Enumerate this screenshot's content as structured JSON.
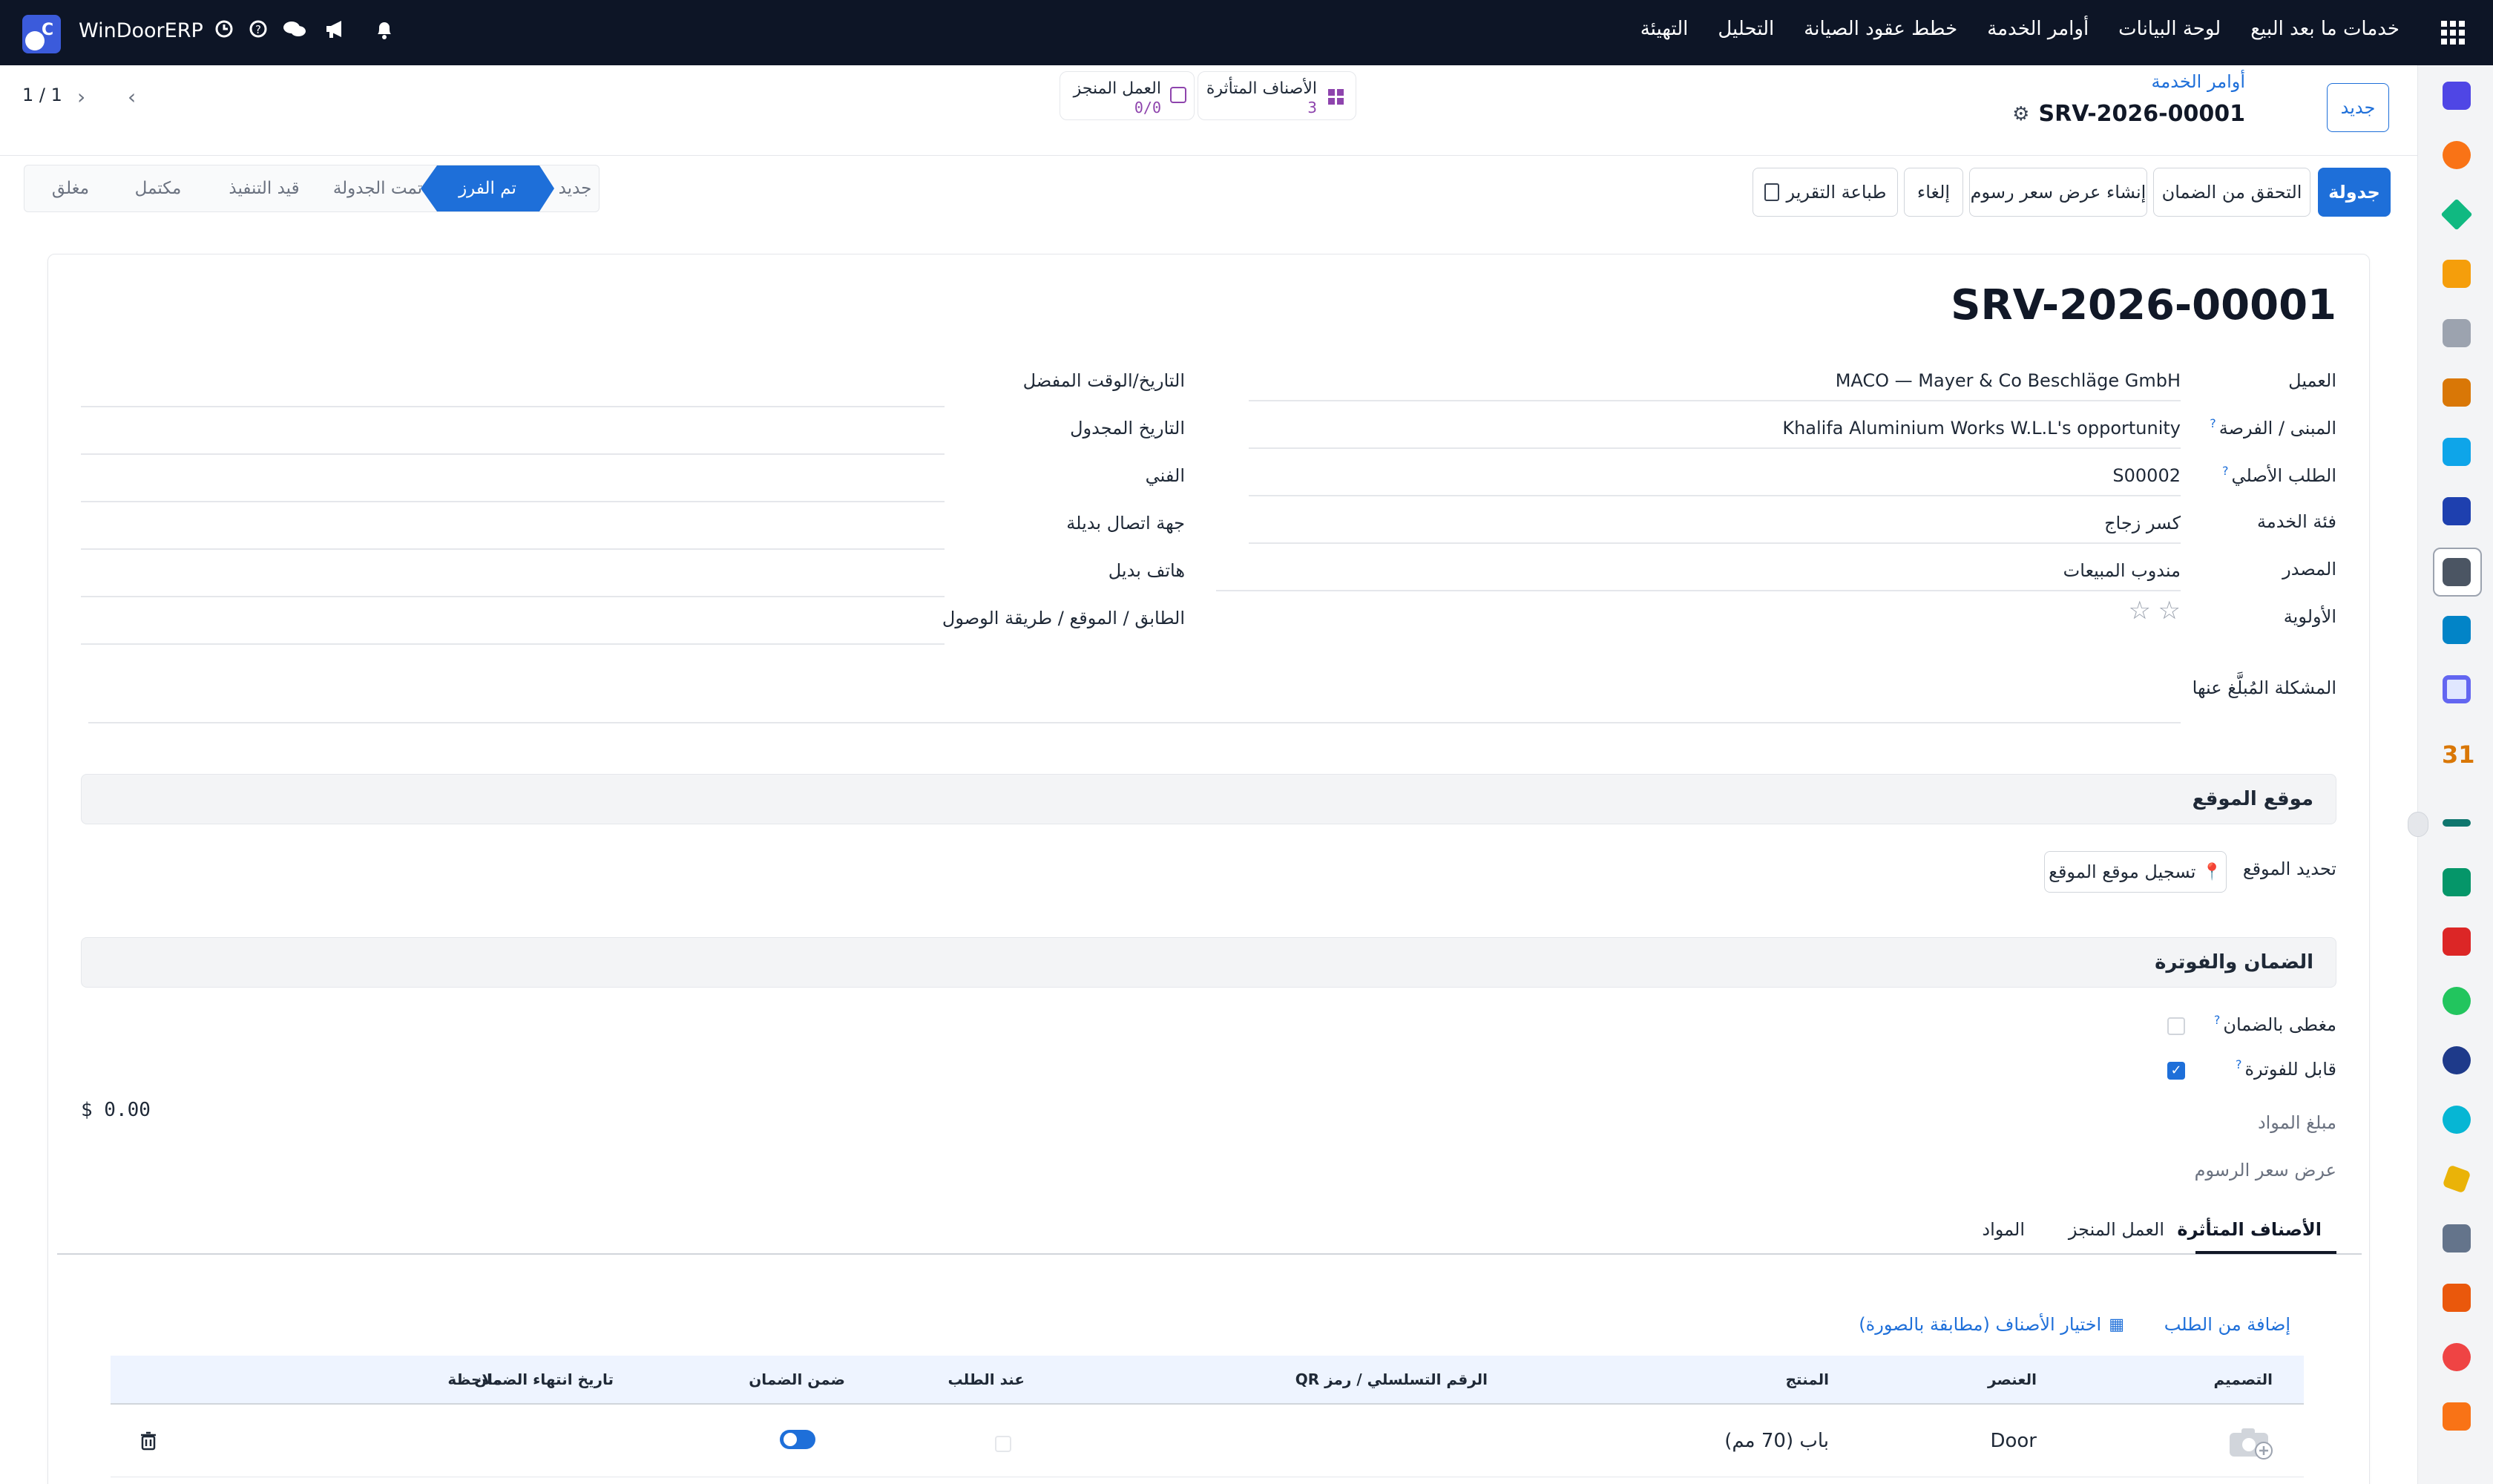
{
  "topbar": {
    "brand": "WinDoorERP",
    "menu": [
      "خدمات ما بعد البيع",
      "لوحة البيانات",
      "أوامر الخدمة",
      "خطط عقود الصيانة",
      "التحليل",
      "التهيئة"
    ]
  },
  "control": {
    "new_button": "جديد",
    "breadcrumb": "أوامر الخدمة",
    "record_title": "SRV-2026-00001",
    "pager": "1 / 1",
    "smart_affected_label": "الأصناف المتأثرة",
    "smart_affected_value": "3",
    "smart_work_label": "العمل المنجز",
    "smart_work_value": "0/0"
  },
  "actions": {
    "schedule": "جدولة",
    "warranty_check": "التحقق من الضمان",
    "create_quote": "إنشاء عرض سعر رسوم",
    "cancel": "إلغاء",
    "print_report": "طباعة التقرير"
  },
  "stages": [
    "جديد",
    "تم الفرز",
    "تمت الجدولة",
    "قيد التنفيذ",
    "مكتمل",
    "مغلق"
  ],
  "form": {
    "title": "SRV-2026-00001",
    "customer_label": "العميل",
    "customer_value": "MACO — Mayer & Co Beschläge GmbH",
    "building_label": "المبنى / الفرصة",
    "building_value": "Khalifa Aluminium Works W.L.L's opportunity",
    "order_label": "الطلب الأصلي",
    "order_value": "S00002",
    "category_label": "فئة الخدمة",
    "category_value": "كسر زجاج",
    "source_label": "المصدر",
    "source_value": "مندوب المبيعات",
    "priority_label": "الأولوية",
    "issue_label": "المشكلة المُبلَّغ عنها",
    "pref_date_label": "التاريخ/الوقت المفضل",
    "sched_date_label": "التاريخ المجدول",
    "tech_label": "الفني",
    "alt_contact_label": "جهة اتصال بديلة",
    "alt_phone_label": "هاتف بديل",
    "floor_label": "الطابق / الموقع / طريقة الوصول",
    "help_mark": "?"
  },
  "location": {
    "section_title": "موقع الموقع",
    "set_location_label": "تحديد الموقع",
    "record_button": "تسجيل موقع الموقع"
  },
  "billing": {
    "section_title": "الضمان والفوترة",
    "warranty_label": "مغطى بالضمان",
    "warranty_checked": false,
    "billable_label": "قابل للفوترة",
    "billable_checked": true,
    "materials_label": "مبلغ المواد",
    "materials_value": "$ 0.00",
    "quote_label": "عرض سعر الرسوم"
  },
  "tabs": [
    "الأصناف المتأثرة",
    "العمل المنجز",
    "المواد"
  ],
  "items": {
    "add_from_order": "إضافة من الطلب",
    "pick_items": "اختيار الأصناف (مطابقة بالصورة)",
    "columns": [
      "التصميم",
      "العنصر",
      "المنتج",
      "الرقم التسلسلي / رمز QR",
      "عند الطلب",
      "ضمن الضمان",
      "تاريخ انتهاء الضمان",
      "ملاحظة"
    ],
    "rows": [
      {
        "element": "Door",
        "product": "باب (70 مم)",
        "on_order": false,
        "in_warranty": true
      }
    ]
  },
  "colors": {
    "nav_bg": "#0d1526",
    "primary": "#1e6fd9",
    "smart_accent": "#8e44ad"
  }
}
